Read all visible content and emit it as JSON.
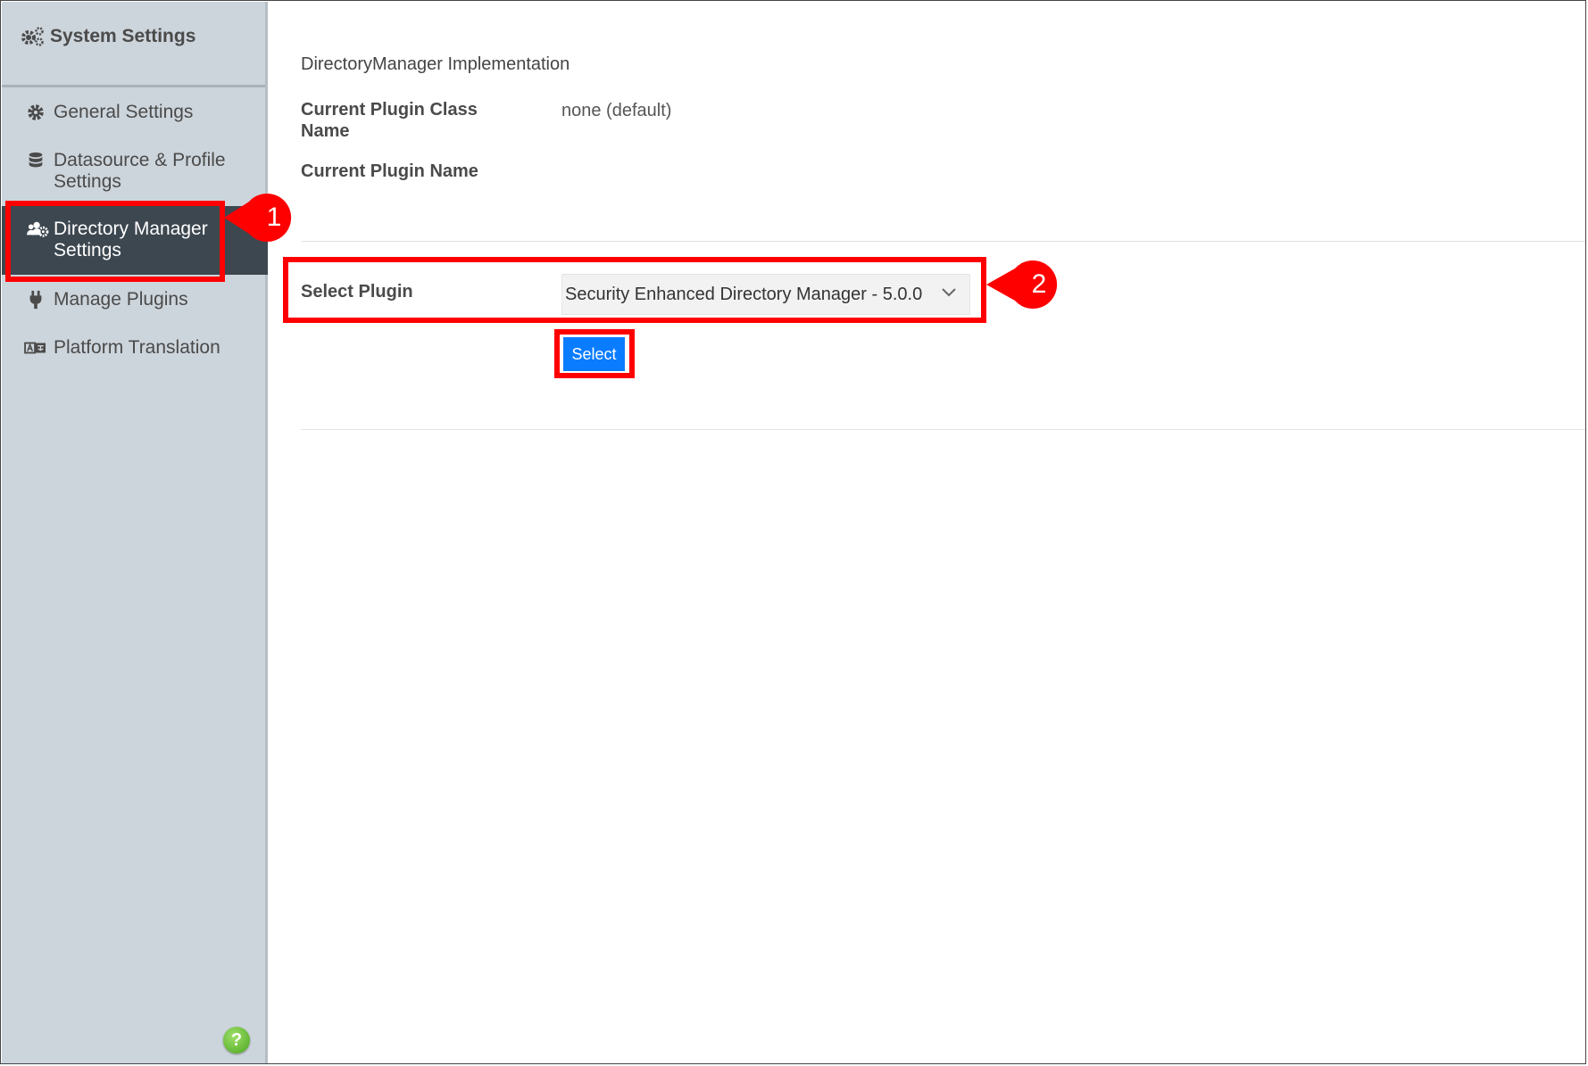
{
  "sidebar": {
    "title": "System Settings",
    "items": [
      {
        "label": "General Settings",
        "icon": "gear-icon"
      },
      {
        "label": "Datasource & Profile",
        "label2": "Settings",
        "icon": "database-icon"
      },
      {
        "label": "Directory Manager",
        "label2": "Settings",
        "icon": "users-cog-icon",
        "active": true
      },
      {
        "label": "Manage Plugins",
        "icon": "plug-icon"
      },
      {
        "label": "Platform Translation",
        "icon": "translate-icon"
      }
    ],
    "help": "?"
  },
  "main": {
    "section_title": "DirectoryManager Implementation",
    "current_class_label_1": "Current Plugin Class",
    "current_class_label_2": "Name",
    "current_class_value": "none (default)",
    "current_name_label": "Current Plugin Name",
    "select_plugin_label": "Select Plugin",
    "select_plugin_value": "Security Enhanced Directory Manager - 5.0.0",
    "select_button": "Select"
  },
  "annotations": {
    "callout_1": "1",
    "callout_2": "2",
    "color": "#ff0000"
  },
  "colors": {
    "sidebar_bg": "#cdd5dc",
    "sidebar_active_bg": "#3d4750",
    "button_blue": "#0a7cff"
  }
}
